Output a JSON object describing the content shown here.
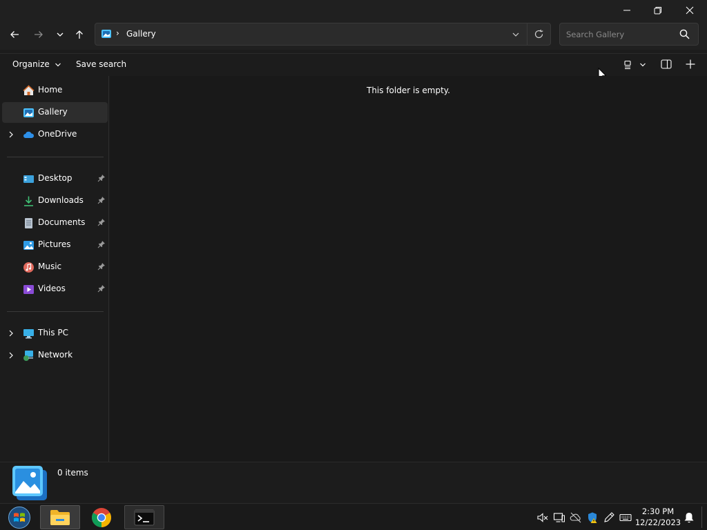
{
  "titlebar": {
    "minimize_icon": "minimize-icon",
    "maximize_icon": "restore-icon",
    "close_icon": "close-icon"
  },
  "address": {
    "location_icon": "gallery-icon",
    "path": "Gallery",
    "separator": "›",
    "search_placeholder": "Search Gallery"
  },
  "commands": {
    "organize": "Organize",
    "save_search": "Save search"
  },
  "nav": {
    "items": [
      {
        "label": "Home",
        "icon": "home-icon"
      },
      {
        "label": "Gallery",
        "icon": "gallery-icon",
        "selected": true
      },
      {
        "label": "OneDrive",
        "icon": "cloud-icon",
        "expandable": true
      },
      {
        "label": "Desktop",
        "icon": "desktop-icon",
        "pinned": true
      },
      {
        "label": "Downloads",
        "icon": "download-icon",
        "pinned": true
      },
      {
        "label": "Documents",
        "icon": "document-icon",
        "pinned": true
      },
      {
        "label": "Pictures",
        "icon": "pictures-icon",
        "pinned": true
      },
      {
        "label": "Music",
        "icon": "music-icon",
        "pinned": true
      },
      {
        "label": "Videos",
        "icon": "video-icon",
        "pinned": true
      },
      {
        "label": "This PC",
        "icon": "computer-icon",
        "expandable": true
      },
      {
        "label": "Network",
        "icon": "network-icon",
        "expandable": true
      }
    ]
  },
  "content": {
    "empty_message": "This folder is empty."
  },
  "details": {
    "item_count": "0 items"
  },
  "taskbar": {
    "apps": [
      "start-orb-icon",
      "file-explorer-icon",
      "chrome-icon",
      "terminal-icon"
    ],
    "time": "2:30 PM",
    "date": "12/22/2023"
  },
  "colors": {
    "background": "#1c1c1c",
    "selected": "#2d2d2d",
    "accent": "#4cc2ff"
  }
}
